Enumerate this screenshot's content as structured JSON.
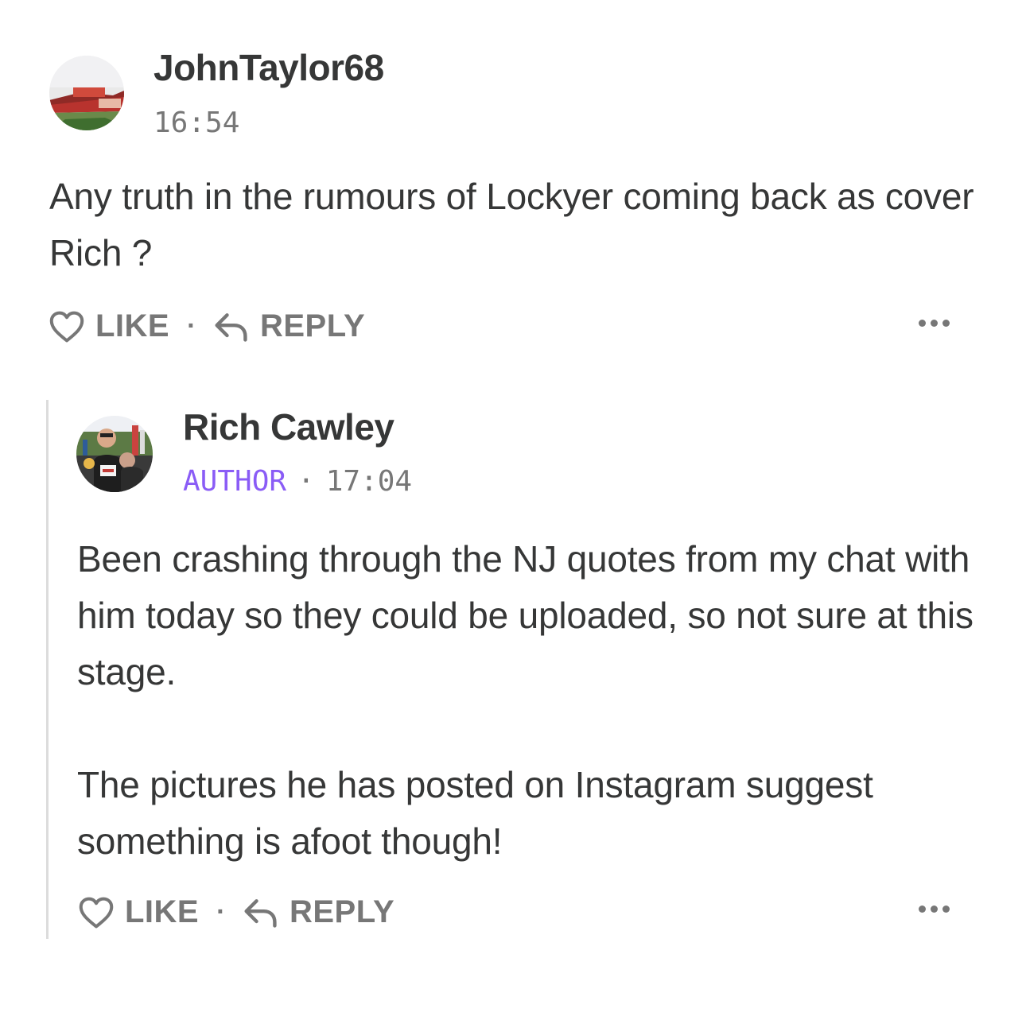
{
  "comments": [
    {
      "author": "JohnTaylor68",
      "time": "16:54",
      "body": [
        "Any truth in the rumours of Lockyer coming back as cover Rich ?"
      ],
      "like_label": "LIKE",
      "separator": "·",
      "reply_label": "REPLY"
    },
    {
      "author": "Rich Cawley",
      "badge": "AUTHOR",
      "meta_separator": "·",
      "time": "17:04",
      "body": [
        "Been crashing through the NJ quotes from my chat with him today so they could be uploaded, so not sure at this stage.",
        "The pictures he has posted on Instagram suggest something is afoot though!"
      ],
      "like_label": "LIKE",
      "separator": "·",
      "reply_label": "REPLY"
    }
  ],
  "colors": {
    "text": "#363737",
    "muted": "#777777",
    "author_badge": "#8a5cf6",
    "thread_line": "#dcdcdc"
  },
  "icons": {
    "like": "heart-outline-icon",
    "reply": "reply-arrow-icon",
    "more": "more-dots-icon"
  }
}
